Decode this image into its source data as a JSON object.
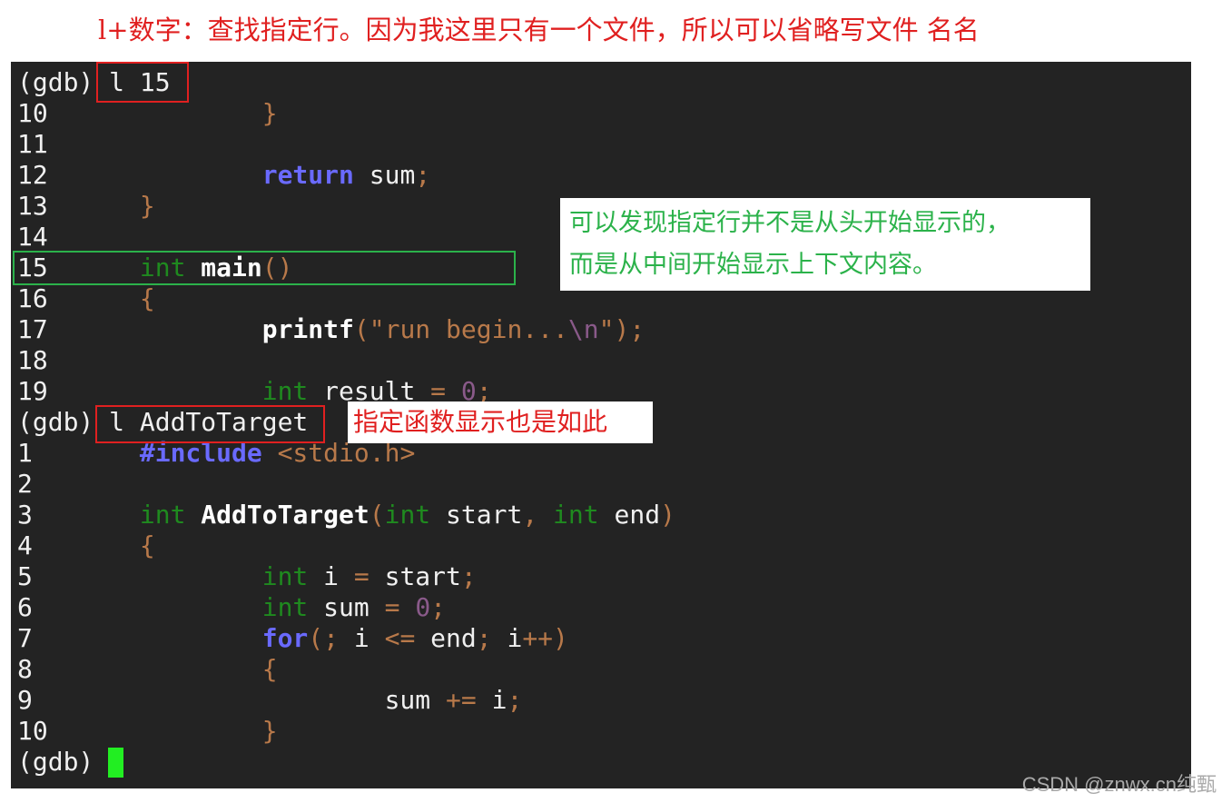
{
  "annotations": {
    "heading": "l+数字：查找指定行。因为我这里只有一个文件，所以可以省略写文件 名名",
    "green_note_line1": "可以发现指定行并不是从头开始显示的，",
    "green_note_line2": "而是从中间开始显示上下文内容。",
    "red_note": "指定函数显示也是如此"
  },
  "colors": {
    "accent_red": "#e02020",
    "accent_green": "#2bb24a",
    "terminal_bg": "#232323",
    "cursor": "#22ee22"
  },
  "terminal": {
    "lines": [
      [
        [
          "(gdb) l 15",
          ""
        ]
      ],
      [
        [
          "10      ",
          ""
        ],
        [
          "        }",
          "p"
        ]
      ],
      [
        [
          "11",
          ""
        ]
      ],
      [
        [
          "12              ",
          ""
        ],
        [
          "return",
          "ctl"
        ],
        [
          " sum",
          ""
        ],
        [
          ";",
          "p"
        ]
      ],
      [
        [
          "13      ",
          ""
        ],
        [
          "}",
          "p"
        ]
      ],
      [
        [
          "14",
          ""
        ]
      ],
      [
        [
          "15      ",
          ""
        ],
        [
          "int",
          "kw"
        ],
        [
          " ",
          ""
        ],
        [
          "main",
          "fn"
        ],
        [
          "()",
          "p"
        ]
      ],
      [
        [
          "16      ",
          ""
        ],
        [
          "{",
          "p"
        ]
      ],
      [
        [
          "17              ",
          ""
        ],
        [
          "printf",
          "fn"
        ],
        [
          "(",
          "p"
        ],
        [
          "\"run begin...",
          "s"
        ],
        [
          "\\n",
          "esc"
        ],
        [
          "\"",
          "s"
        ],
        [
          ");",
          "p"
        ]
      ],
      [
        [
          "18",
          ""
        ]
      ],
      [
        [
          "19              ",
          ""
        ],
        [
          "int",
          "kw"
        ],
        [
          " result ",
          ""
        ],
        [
          "=",
          "p"
        ],
        [
          " ",
          ""
        ],
        [
          "0",
          "num"
        ],
        [
          ";",
          "p"
        ]
      ],
      [
        [
          "(gdb) l AddToTarget",
          ""
        ]
      ],
      [
        [
          "1       ",
          ""
        ],
        [
          "#include",
          "ctl"
        ],
        [
          " ",
          ""
        ],
        [
          "<stdio.h>",
          "hdr"
        ]
      ],
      [
        [
          "2",
          ""
        ]
      ],
      [
        [
          "3       ",
          ""
        ],
        [
          "int",
          "kw"
        ],
        [
          " ",
          ""
        ],
        [
          "AddToTarget",
          "fn"
        ],
        [
          "(",
          "p"
        ],
        [
          "int",
          "kw"
        ],
        [
          " start",
          ""
        ],
        [
          ",",
          "p"
        ],
        [
          " ",
          ""
        ],
        [
          "int",
          "kw"
        ],
        [
          " end",
          ""
        ],
        [
          ")",
          "p"
        ]
      ],
      [
        [
          "4       ",
          ""
        ],
        [
          "{",
          "p"
        ]
      ],
      [
        [
          "5               ",
          ""
        ],
        [
          "int",
          "kw"
        ],
        [
          " i ",
          ""
        ],
        [
          "=",
          "p"
        ],
        [
          " start",
          ""
        ],
        [
          ";",
          "p"
        ]
      ],
      [
        [
          "6               ",
          ""
        ],
        [
          "int",
          "kw"
        ],
        [
          " sum ",
          ""
        ],
        [
          "=",
          "p"
        ],
        [
          " ",
          ""
        ],
        [
          "0",
          "num"
        ],
        [
          ";",
          "p"
        ]
      ],
      [
        [
          "7               ",
          ""
        ],
        [
          "for",
          "ctl"
        ],
        [
          "(",
          "p"
        ],
        [
          ";",
          "p"
        ],
        [
          " i ",
          ""
        ],
        [
          "<=",
          "p"
        ],
        [
          " end",
          ""
        ],
        [
          ";",
          "p"
        ],
        [
          " i",
          ""
        ],
        [
          "++",
          "p"
        ],
        [
          ")",
          "p"
        ]
      ],
      [
        [
          "8               ",
          ""
        ],
        [
          "{",
          "p"
        ]
      ],
      [
        [
          "9                       ",
          ""
        ],
        [
          "sum ",
          ""
        ],
        [
          "+=",
          "p"
        ],
        [
          " i",
          ""
        ],
        [
          ";",
          "p"
        ]
      ],
      [
        [
          "10              ",
          ""
        ],
        [
          "}",
          "p"
        ]
      ],
      [
        [
          "(gdb) ",
          ""
        ]
      ]
    ]
  },
  "watermark": "CSDN @znwx.cn纯甄"
}
